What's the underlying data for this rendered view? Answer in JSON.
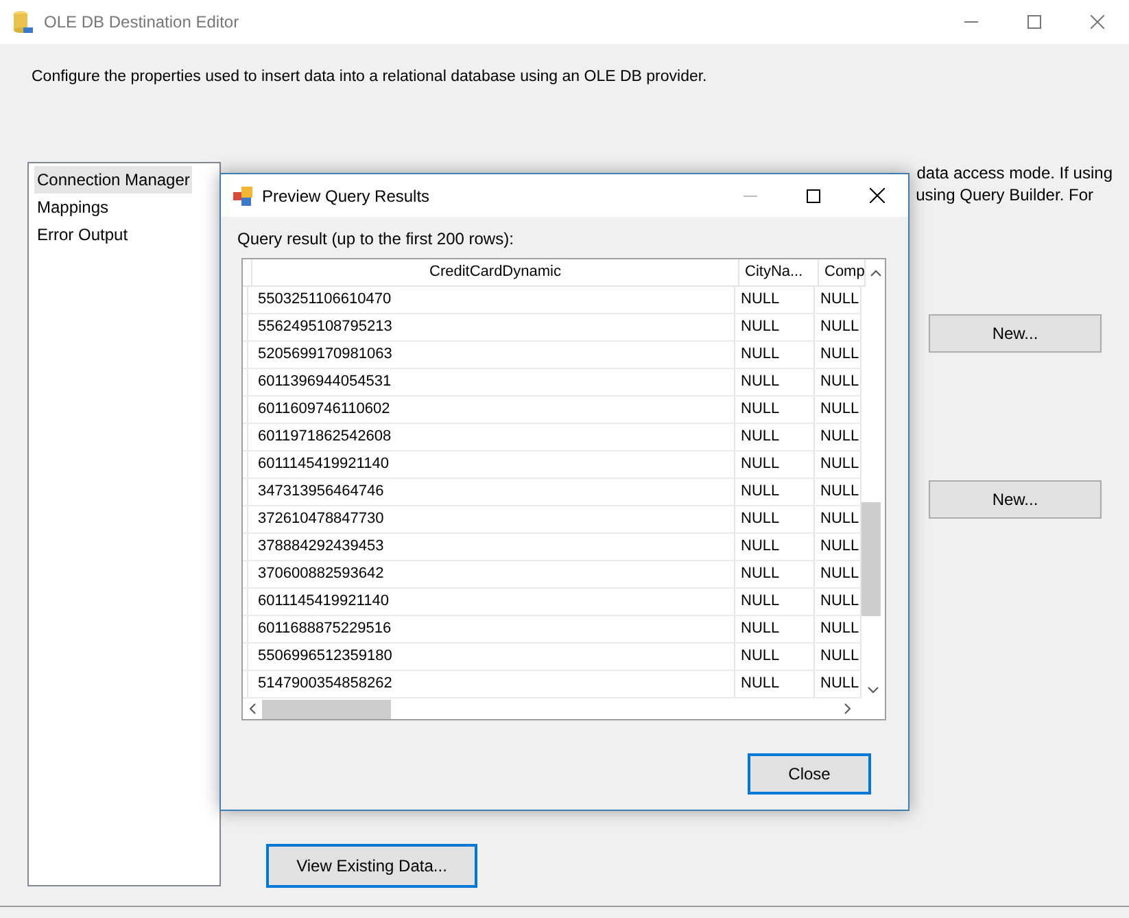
{
  "window": {
    "title": "OLE DB Destination Editor"
  },
  "description": "Configure the properties used to insert data into a relational database using an OLE DB provider.",
  "sidebar": {
    "items": [
      {
        "label": "Connection Manager",
        "selected": true
      },
      {
        "label": "Mappings",
        "selected": false
      },
      {
        "label": "Error Output",
        "selected": false
      }
    ]
  },
  "instructions": [
    "data access mode. If using",
    "using Query Builder. For"
  ],
  "new_buttons": [
    "New...",
    "New..."
  ],
  "view_button": "View Existing Data...",
  "dialog": {
    "title": "Preview Query Results",
    "label": "Query result (up to the first 200 rows):",
    "columns": [
      "CreditCardDynamic",
      "CityNa...",
      "Comp"
    ],
    "rows": [
      [
        "5503251106610470",
        "NULL",
        "NULL"
      ],
      [
        "5562495108795213",
        "NULL",
        "NULL"
      ],
      [
        "5205699170981063",
        "NULL",
        "NULL"
      ],
      [
        "6011396944054531",
        "NULL",
        "NULL"
      ],
      [
        "6011609746110602",
        "NULL",
        "NULL"
      ],
      [
        "6011971862542608",
        "NULL",
        "NULL"
      ],
      [
        "6011145419921140",
        "NULL",
        "NULL"
      ],
      [
        "347313956464746",
        "NULL",
        "NULL"
      ],
      [
        "372610478847730",
        "NULL",
        "NULL"
      ],
      [
        "378884292439453",
        "NULL",
        "NULL"
      ],
      [
        "370600882593642",
        "NULL",
        "NULL"
      ],
      [
        "6011145419921140",
        "NULL",
        "NULL"
      ],
      [
        "6011688875229516",
        "NULL",
        "NULL"
      ],
      [
        "5506996512359180",
        "NULL",
        "NULL"
      ],
      [
        "5147900354858262",
        "NULL",
        "NULL"
      ]
    ],
    "close_button": "Close"
  }
}
